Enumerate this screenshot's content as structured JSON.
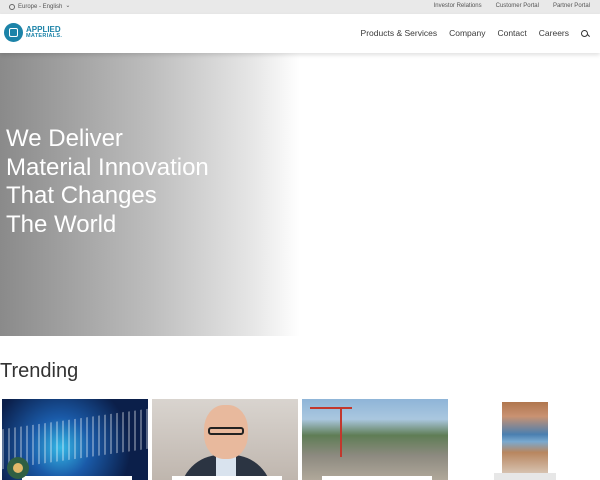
{
  "topbar": {
    "locale": "Europe - English",
    "links": [
      "Investor Relations",
      "Customer Portal",
      "Partner Portal"
    ]
  },
  "nav": {
    "logo_line1": "APPLIED",
    "logo_line2": "MATERIALS.",
    "items": [
      "Products & Services",
      "Company",
      "Contact",
      "Careers"
    ]
  },
  "hero": {
    "lines": [
      "We Deliver",
      "Material Innovation",
      "That Changes",
      "The World"
    ]
  },
  "trending": {
    "title": "Trending"
  },
  "colors": {
    "brand": "#1c83a8",
    "cookie_button": "#2f5f43"
  },
  "icons": [
    "globe-icon",
    "chevron-down-icon",
    "search-icon",
    "cookie-icon"
  ]
}
